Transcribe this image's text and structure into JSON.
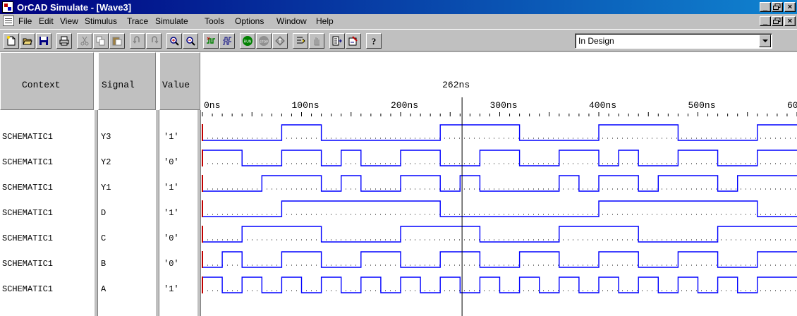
{
  "window": {
    "title": "OrCAD Simulate - [Wave3]",
    "caption_buttons": [
      "_",
      "Θ",
      "×"
    ]
  },
  "menu": {
    "items": [
      "File",
      "Edit",
      "View",
      "Stimulus",
      "Trace",
      "Simulate",
      "Tools",
      "Options",
      "Window",
      "Help"
    ]
  },
  "toolbar": {
    "icons": [
      "new-file-icon",
      "open-folder-icon",
      "save-disk-icon",
      "print-icon",
      "cut-icon",
      "copy-icon",
      "paste-icon",
      "undo-icon",
      "redo-icon",
      "zoom-in-icon",
      "zoom-out-icon",
      "add-trace-icon",
      "waveform-icon",
      "run-icon",
      "stop-icon",
      "step-icon",
      "probe-icon",
      "hand-icon",
      "export-icon",
      "import-icon",
      "help-icon"
    ],
    "run_label": "RUN",
    "stop_label": "STOP",
    "design_select": "In Design"
  },
  "columns": {
    "context": "Context",
    "signal": "Signal",
    "value": "Value"
  },
  "cursor": {
    "label": "262ns",
    "time_ns": 262
  },
  "time_axis": {
    "labels": [
      "0ns",
      "100ns",
      "200ns",
      "300ns",
      "400ns",
      "500ns",
      "600ns"
    ],
    "ticks_ns": [
      0,
      100,
      200,
      300,
      400,
      500,
      600
    ]
  },
  "colors": {
    "waveform": "#0000ff",
    "cursor": "#000000",
    "start_marker": "#c00000",
    "grid_dots": "#000000"
  },
  "signals": [
    {
      "context": "SCHEMATIC1",
      "name": "Y3",
      "value": "'1'",
      "transitions_ns": [
        0,
        80,
        120,
        240,
        320,
        400,
        480,
        560
      ]
    },
    {
      "context": "SCHEMATIC1",
      "name": "Y2",
      "value": "'0'",
      "transitions_ns": [
        0,
        0,
        40,
        80,
        120,
        140,
        160,
        200,
        240,
        280,
        320,
        360,
        400,
        420,
        440,
        480,
        520,
        560
      ]
    },
    {
      "context": "SCHEMATIC1",
      "name": "Y1",
      "value": "'1'",
      "transitions_ns": [
        0,
        60,
        120,
        140,
        160,
        200,
        240,
        260,
        280,
        360,
        380,
        400,
        440,
        460,
        520,
        540
      ]
    },
    {
      "context": "SCHEMATIC1",
      "name": "D",
      "value": "'1'",
      "transitions_ns": [
        0,
        80,
        240,
        400,
        560
      ]
    },
    {
      "context": "SCHEMATIC1",
      "name": "C",
      "value": "'0'",
      "transitions_ns": [
        0,
        40,
        120,
        200,
        280,
        360,
        440,
        520
      ]
    },
    {
      "context": "SCHEMATIC1",
      "name": "B",
      "value": "'0'",
      "transitions_ns": [
        0,
        20,
        40,
        80,
        120,
        160,
        200,
        240,
        280,
        320,
        360,
        400,
        440,
        480,
        520,
        560
      ]
    },
    {
      "context": "SCHEMATIC1",
      "name": "A",
      "value": "'1'",
      "transitions_ns": [
        0,
        0,
        20,
        40,
        60,
        80,
        100,
        120,
        140,
        160,
        180,
        200,
        220,
        240,
        260,
        280,
        300,
        320,
        340,
        360,
        380,
        400,
        420,
        440,
        460,
        480,
        500,
        520,
        540,
        560
      ]
    }
  ]
}
